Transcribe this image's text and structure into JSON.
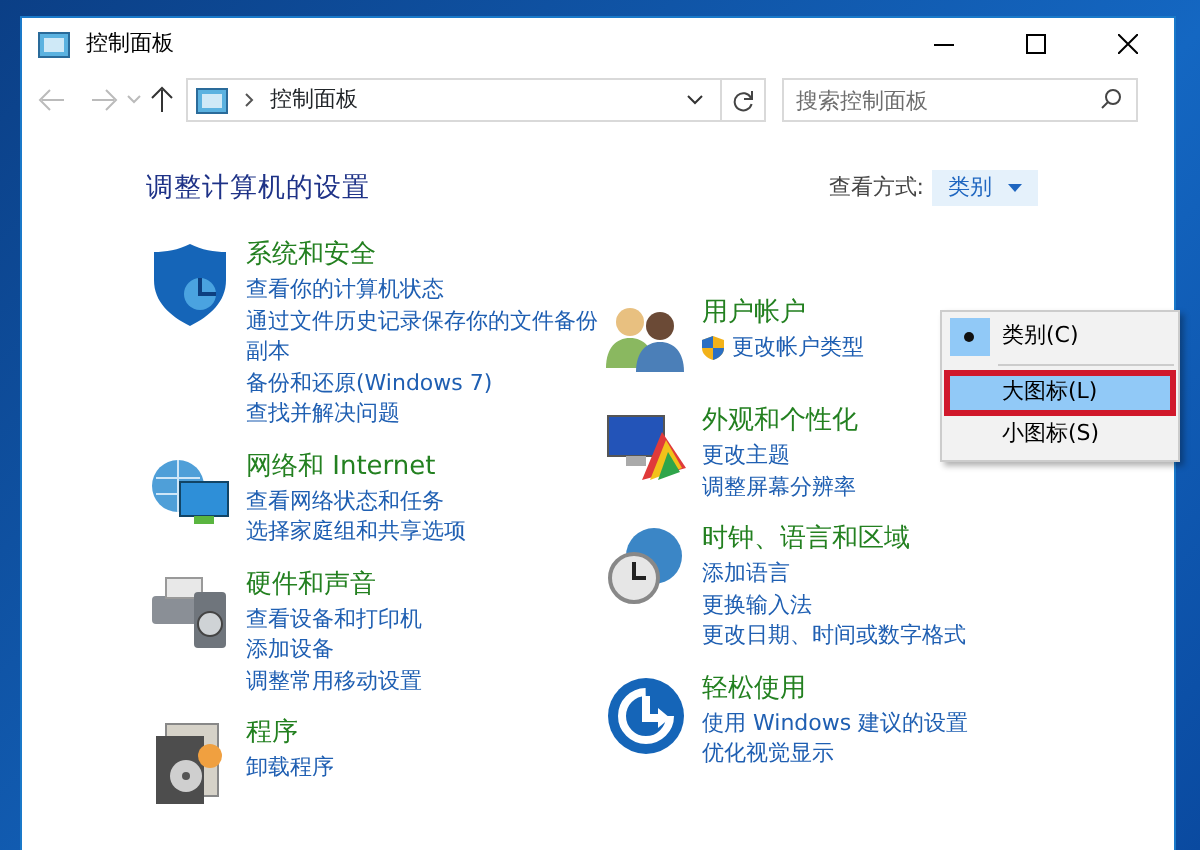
{
  "window": {
    "title": "控制面板"
  },
  "navigation": {
    "address": "控制面板",
    "search_placeholder": "搜索控制面板"
  },
  "heading": "调整计算机的设置",
  "view_by": {
    "label": "查看方式:",
    "value": "类别"
  },
  "view_menu": [
    {
      "label": "类别(C)",
      "selected": true,
      "highlighted": false,
      "outlined": false
    },
    {
      "label": "大图标(L)",
      "selected": false,
      "highlighted": true,
      "outlined": true
    },
    {
      "label": "小图标(S)",
      "selected": false,
      "highlighted": false,
      "outlined": false
    }
  ],
  "columns": [
    {
      "categories": [
        {
          "kind": "security",
          "title": "系统和安全",
          "links": [
            {
              "text": "查看你的计算机状态",
              "kind": "plain"
            },
            {
              "text": "通过文件历史记录保存你的文件备份副本",
              "kind": "plain"
            },
            {
              "text": "备份和还原(Windows 7)",
              "kind": "plain"
            },
            {
              "text": "查找并解决问题",
              "kind": "plain"
            }
          ]
        },
        {
          "kind": "network",
          "title": "网络和 Internet",
          "links": [
            {
              "text": "查看网络状态和任务",
              "kind": "plain"
            },
            {
              "text": "选择家庭组和共享选项",
              "kind": "plain"
            }
          ]
        },
        {
          "kind": "hardware",
          "title": "硬件和声音",
          "links": [
            {
              "text": "查看设备和打印机",
              "kind": "plain"
            },
            {
              "text": "添加设备",
              "kind": "plain"
            },
            {
              "text": "调整常用移动设置",
              "kind": "plain"
            }
          ]
        },
        {
          "kind": "programs",
          "title": "程序",
          "links": [
            {
              "text": "卸载程序",
              "kind": "plain"
            }
          ]
        }
      ]
    },
    {
      "categories": [
        {
          "kind": "users",
          "title": "用户帐户",
          "links": [
            {
              "text": "更改帐户类型",
              "kind": "shield"
            }
          ]
        },
        {
          "kind": "appearance",
          "title": "外观和个性化",
          "links": [
            {
              "text": "更改主题",
              "kind": "plain"
            },
            {
              "text": "调整屏幕分辨率",
              "kind": "plain"
            }
          ]
        },
        {
          "kind": "clock",
          "title": "时钟、语言和区域",
          "links": [
            {
              "text": "添加语言",
              "kind": "plain"
            },
            {
              "text": "更换输入法",
              "kind": "plain"
            },
            {
              "text": "更改日期、时间或数字格式",
              "kind": "plain"
            }
          ]
        },
        {
          "kind": "ease",
          "title": "轻松使用",
          "links": [
            {
              "text": "使用 Windows 建议的设置",
              "kind": "plain"
            },
            {
              "text": "优化视觉显示",
              "kind": "plain"
            }
          ]
        }
      ]
    }
  ]
}
